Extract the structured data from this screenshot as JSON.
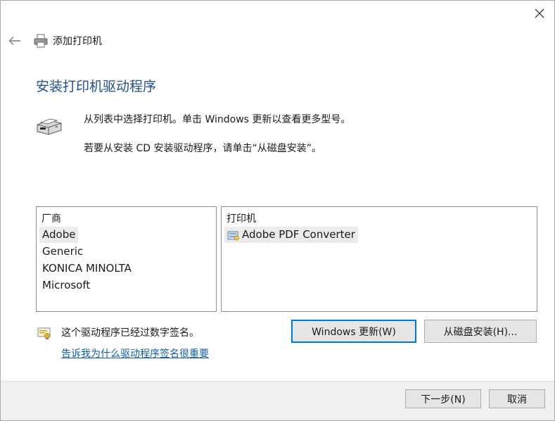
{
  "header": {
    "wizard_title": "添加打印机"
  },
  "main": {
    "heading": "安装打印机驱动程序",
    "description_line1": "从列表中选择打印机。单击 Windows 更新以查看更多型号。",
    "description_line2": "若要从安装 CD 安装驱动程序，请单击“从磁盘安装”。"
  },
  "manufacturers": {
    "header": "厂商",
    "items": [
      "Adobe",
      "Generic",
      "KONICA MINOLTA",
      "Microsoft"
    ],
    "selected": "Adobe"
  },
  "printers": {
    "header": "打印机",
    "items": [
      "Adobe PDF Converter"
    ],
    "selected": "Adobe PDF Converter"
  },
  "signature": {
    "status_text": "这个驱动程序已经过数字签名。",
    "link_text": "告诉我为什么驱动程序签名很重要"
  },
  "buttons": {
    "windows_update": "Windows 更新(W)",
    "have_disk": "从磁盘安装(H)...",
    "next": "下一步(N)",
    "cancel": "取消"
  },
  "icons": {
    "close": "close-icon",
    "back": "back-arrow-icon",
    "title": "printer-icon",
    "description": "printer-icon",
    "printer_item": "printer-driver-icon",
    "signature": "certificate-icon"
  },
  "colors": {
    "heading": "#1f4e96",
    "link": "#0f5fae",
    "default_button_border": "#0078d7",
    "footer_background": "#f0f0f0"
  }
}
